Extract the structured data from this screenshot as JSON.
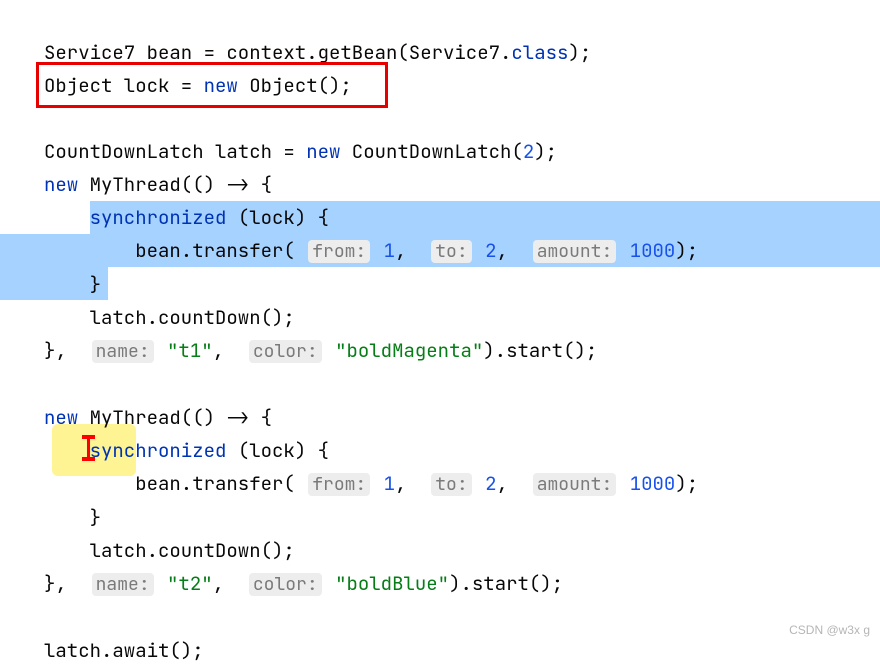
{
  "code": {
    "l1_a": "Service7 bean = context.getBean(Service7.",
    "l1_kw_class": "class",
    "l1_b": ");",
    "l2_a": "Object lock = ",
    "l2_kw_new": "new",
    "l2_b": " Object();",
    "l4_a": "CountDownLatch latch = ",
    "l4_kw_new": "new",
    "l4_b": " CountDownLatch(",
    "l4_num": "2",
    "l4_c": ");",
    "l5_kw_new": "new",
    "l5_a": " MyThread(() -> {",
    "l6_kw_sync": "synchronized",
    "l6_a": " (lock) {",
    "l7_a": "bean.transfer(",
    "l7_num1": "1",
    "l7_comma1": ",",
    "l7_num2": "2",
    "l7_comma2": ",",
    "l7_num3": "1000",
    "l7_b": ");",
    "l8_a": "}",
    "l9_a": "latch.countDown();",
    "l10_a": "},",
    "l10_str_name": "\"t1\"",
    "l10_comma": ",",
    "l10_str_color": "\"boldMagenta\"",
    "l10_b": ").start();",
    "l12_kw_new": "new",
    "l12_a": " MyThread(() -> {",
    "l13_kw_sync": "synchronized",
    "l13_a": " (lock) {",
    "l14_a": "bean.transfer(",
    "l14_num1": "1",
    "l14_comma1": ",",
    "l14_num2": "2",
    "l14_comma2": ",",
    "l14_num3": "1000",
    "l14_b": ");",
    "l15_a": "}",
    "l16_a": "latch.countDown();",
    "l17_a": "},",
    "l17_str_name": "\"t2\"",
    "l17_comma": ",",
    "l17_str_color": "\"boldBlue\"",
    "l17_b": ").start();",
    "l19_a": "latch.await();"
  },
  "hints": {
    "from": "from:",
    "to": "to:",
    "amount": "amount:",
    "name": "name:",
    "color": "color:"
  },
  "watermark": "CSDN @w3x g"
}
